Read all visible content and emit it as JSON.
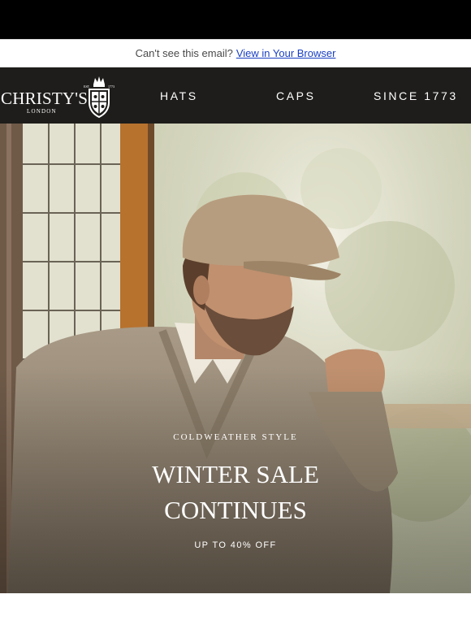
{
  "browser_bar": {
    "prompt": "Can't see this email?",
    "link_label": "View in Your Browser"
  },
  "logo": {
    "wordmark": "CHRISTY'S",
    "subtitle": "LONDON",
    "crest_left": "EST.",
    "crest_right": "1773"
  },
  "nav": {
    "items": [
      {
        "label": "HATS"
      },
      {
        "label": "CAPS"
      },
      {
        "label": "SINCE 1773"
      }
    ]
  },
  "hero": {
    "eyebrow": "COLDWEATHER STYLE",
    "headline_line1": "WINTER SALE",
    "headline_line2": "CONTINUES",
    "subline": "UP TO 40% OFF"
  },
  "colors": {
    "nav_bg": "#1e1d1b",
    "top_bg": "#000000",
    "link": "#1a3fc2"
  }
}
